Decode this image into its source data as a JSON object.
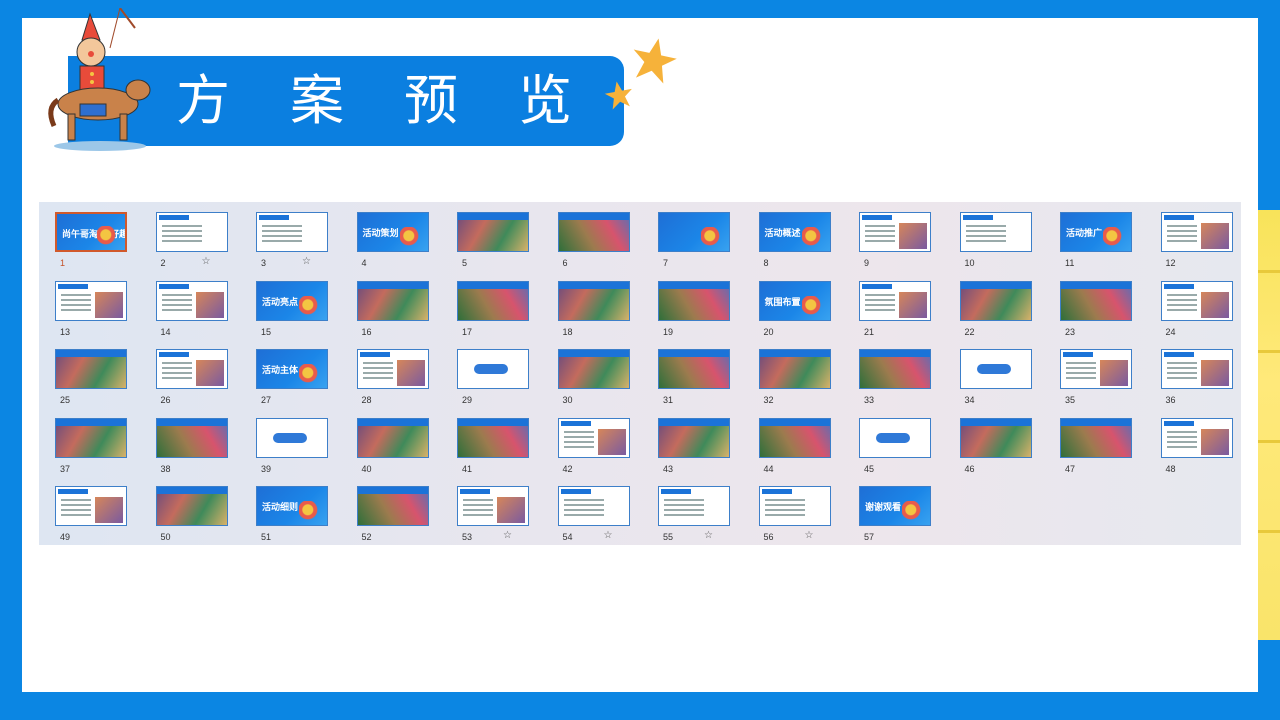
{
  "title": "方案预览",
  "colors": {
    "frame": "#0b86e3",
    "title_bar": "#0b7fe0",
    "selected_border": "#d1592b",
    "thumb_border": "#3d7fc9"
  },
  "slides": [
    {
      "n": "1",
      "style": "blue",
      "label": "尚午哥淘乐 好趣好玩",
      "star": false,
      "selected": true
    },
    {
      "n": "2",
      "style": "doc",
      "star": true
    },
    {
      "n": "3",
      "style": "doc",
      "star": true
    },
    {
      "n": "4",
      "style": "blue",
      "label": "活动策划",
      "star": false
    },
    {
      "n": "5",
      "style": "photo",
      "star": false
    },
    {
      "n": "6",
      "style": "photo2",
      "star": false
    },
    {
      "n": "7",
      "style": "blue",
      "star": false
    },
    {
      "n": "8",
      "style": "blue",
      "label": "活动概述",
      "star": false
    },
    {
      "n": "9",
      "style": "docpic",
      "star": false
    },
    {
      "n": "10",
      "style": "doc",
      "star": false
    },
    {
      "n": "11",
      "style": "blue",
      "label": "活动推广",
      "star": false
    },
    {
      "n": "12",
      "style": "docpic",
      "star": false
    },
    {
      "n": "13",
      "style": "docpic",
      "star": false
    },
    {
      "n": "14",
      "style": "docpic",
      "star": false
    },
    {
      "n": "15",
      "style": "blue",
      "label": "活动亮点",
      "star": false
    },
    {
      "n": "16",
      "style": "photo",
      "star": false
    },
    {
      "n": "17",
      "style": "photo2",
      "star": false
    },
    {
      "n": "18",
      "style": "photo",
      "star": false
    },
    {
      "n": "19",
      "style": "photo2",
      "star": false
    },
    {
      "n": "20",
      "style": "blue",
      "label": "氛围布置",
      "star": false
    },
    {
      "n": "21",
      "style": "docpic",
      "star": false
    },
    {
      "n": "22",
      "style": "photo",
      "star": false
    },
    {
      "n": "23",
      "style": "photo2",
      "star": false
    },
    {
      "n": "24",
      "style": "docpic",
      "star": false
    },
    {
      "n": "25",
      "style": "photo",
      "star": false
    },
    {
      "n": "26",
      "style": "docpic",
      "star": false
    },
    {
      "n": "27",
      "style": "blue",
      "label": "活动主体",
      "star": false
    },
    {
      "n": "28",
      "style": "docpic",
      "star": false
    },
    {
      "n": "29",
      "style": "banner",
      "star": false
    },
    {
      "n": "30",
      "style": "photo",
      "star": false
    },
    {
      "n": "31",
      "style": "photo2",
      "star": false
    },
    {
      "n": "32",
      "style": "photo",
      "star": false
    },
    {
      "n": "33",
      "style": "photo2",
      "star": false
    },
    {
      "n": "34",
      "style": "banner",
      "star": false
    },
    {
      "n": "35",
      "style": "docpic",
      "star": false
    },
    {
      "n": "36",
      "style": "docpic",
      "star": false
    },
    {
      "n": "37",
      "style": "photo",
      "star": false
    },
    {
      "n": "38",
      "style": "photo2",
      "star": false
    },
    {
      "n": "39",
      "style": "banner",
      "star": false
    },
    {
      "n": "40",
      "style": "photo",
      "star": false
    },
    {
      "n": "41",
      "style": "photo2",
      "star": false
    },
    {
      "n": "42",
      "style": "docpic",
      "star": false
    },
    {
      "n": "43",
      "style": "photo",
      "star": false
    },
    {
      "n": "44",
      "style": "photo2",
      "star": false
    },
    {
      "n": "45",
      "style": "banner",
      "star": false
    },
    {
      "n": "46",
      "style": "photo",
      "star": false
    },
    {
      "n": "47",
      "style": "photo2",
      "star": false
    },
    {
      "n": "48",
      "style": "docpic",
      "star": false
    },
    {
      "n": "49",
      "style": "docpic",
      "star": false
    },
    {
      "n": "50",
      "style": "photo",
      "star": false
    },
    {
      "n": "51",
      "style": "blue",
      "label": "活动细则",
      "star": false
    },
    {
      "n": "52",
      "style": "photo2",
      "star": false
    },
    {
      "n": "53",
      "style": "docpic",
      "star": true
    },
    {
      "n": "54",
      "style": "doc",
      "star": true
    },
    {
      "n": "55",
      "style": "doc",
      "star": true
    },
    {
      "n": "56",
      "style": "doc",
      "star": true
    },
    {
      "n": "57",
      "style": "blue",
      "label": "谢谢观看",
      "star": false
    }
  ],
  "icons": {
    "star_marker": "☆"
  }
}
